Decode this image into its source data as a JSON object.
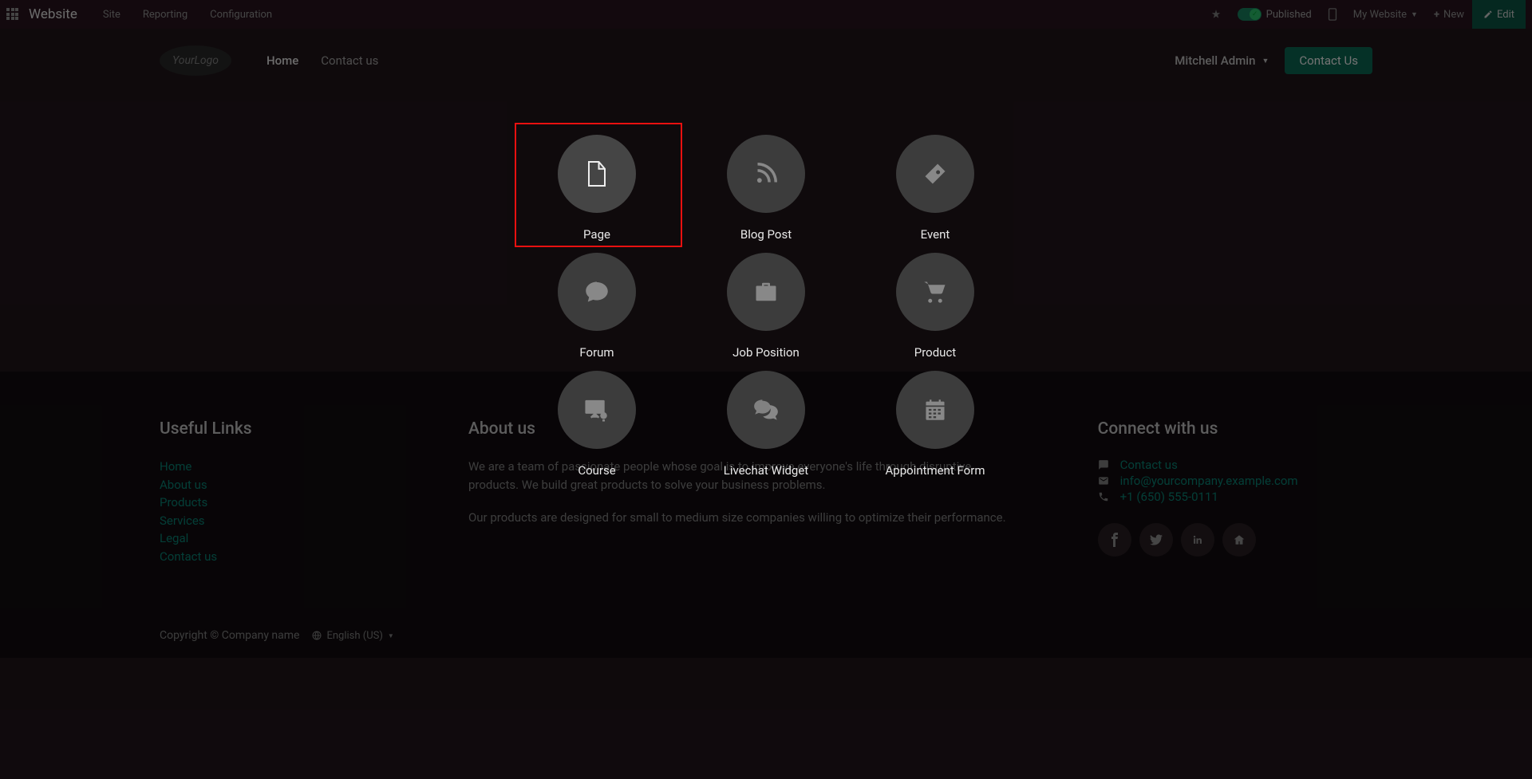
{
  "toolbar": {
    "title": "Website",
    "menu_items": [
      "Site",
      "Reporting",
      "Configuration"
    ],
    "published_label": "Published",
    "my_website": "My Website",
    "new_label": "New",
    "edit_label": "Edit"
  },
  "header": {
    "logo_text": "YourLogo",
    "nav": {
      "home": "Home",
      "contact": "Contact us"
    },
    "user_name": "Mitchell Admin",
    "contact_btn": "Contact Us"
  },
  "modal": {
    "items": [
      {
        "label": "Page",
        "icon": "page"
      },
      {
        "label": "Blog Post",
        "icon": "rss"
      },
      {
        "label": "Event",
        "icon": "ticket"
      },
      {
        "label": "Forum",
        "icon": "chat"
      },
      {
        "label": "Job Position",
        "icon": "briefcase"
      },
      {
        "label": "Product",
        "icon": "cart"
      },
      {
        "label": "Course",
        "icon": "presentation"
      },
      {
        "label": "Livechat Widget",
        "icon": "chats"
      },
      {
        "label": "Appointment Form",
        "icon": "calendar"
      }
    ]
  },
  "footer": {
    "useful_links": {
      "title": "Useful Links",
      "items": [
        "Home",
        "About us",
        "Products",
        "Services",
        "Legal",
        "Contact us"
      ]
    },
    "about": {
      "title": "About us",
      "p1": "We are a team of passionate people whose goal is to improve everyone's life through disruptive products. We build great products to solve your business problems.",
      "p2": "Our products are designed for small to medium size companies willing to optimize their performance."
    },
    "connect": {
      "title": "Connect with us",
      "contact_us": "Contact us",
      "email": "info@yourcompany.example.com",
      "phone": "+1 (650) 555-0111"
    },
    "copyright": "Copyright © Company name",
    "language": "English (US)"
  }
}
